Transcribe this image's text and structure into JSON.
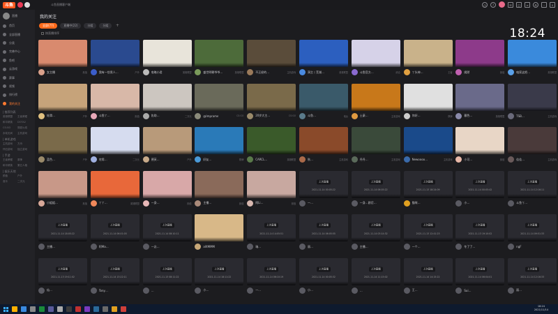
{
  "app": {
    "logo_text": "斗鱼",
    "window_title": "斗鱼直播客户端"
  },
  "titlebar": {
    "icons": [
      "clock-icon",
      "help-icon",
      "avatar",
      "mail-icon",
      "skin-icon",
      "menu-icon",
      "settings-icon",
      "minimize-icon",
      "close-icon"
    ]
  },
  "sidebar": {
    "user": "直播",
    "items": [
      {
        "label": "首页"
      },
      {
        "label": "全部直播"
      },
      {
        "label": "分类"
      },
      {
        "label": "完善中心"
      },
      {
        "label": "鱼吧"
      },
      {
        "label": "云游戏"
      },
      {
        "label": "赛事"
      },
      {
        "label": "视频"
      },
      {
        "label": "排行榜"
      },
      {
        "label": "我的关注"
      }
    ],
    "groups": [
      {
        "title": "| 推荐列表",
        "subs": [
          "英雄联盟",
          "王者荣耀",
          "和平精英",
          "DOTA2",
          "CS:GO",
          "穿越火线",
          "永劫无间",
          "主机游戏"
        ]
      },
      {
        "title": "| 单机游戏",
        "subs": [
          "主机游戏",
          "方舟",
          "怀旧游戏",
          "独立游戏"
        ]
      },
      {
        "title": "| 手游",
        "subs": [
          "王者荣耀",
          "原神",
          "和平精英",
          "第五人格"
        ]
      },
      {
        "title": "| 娱乐天地",
        "subs": [
          "颜值",
          "户外",
          "音乐",
          "二次元"
        ]
      }
    ]
  },
  "main": {
    "title": "我的关注",
    "clock": "18:24",
    "tabs": [
      "全部(77)",
      "直播中(22)",
      "分组",
      "分组"
    ],
    "sort_label": "按直播排序"
  },
  "offline_label": "上次直播",
  "cards": [
    {
      "name": "女主播",
      "game": "颜值",
      "color": "#d98a6e",
      "avatar": "#d9a08a",
      "live": true
    },
    {
      "name": "我有一些男人…",
      "game": "户外",
      "color": "#2a4a8f",
      "avatar": "#3b5dc9",
      "live": true
    },
    {
      "name": "攻略小君",
      "game": "英雄联盟",
      "color": "#e8e4da",
      "avatar": "#bbbbbb",
      "live": true
    },
    {
      "name": "盛世明朝爷爷…",
      "game": "英雄联盟",
      "color": "#4d6b3a",
      "avatar": "#7a9a5a",
      "live": true
    },
    {
      "name": "不正经的…",
      "game": "主机游戏",
      "color": "#5a4c3a",
      "avatar": "#9a7a5a",
      "live": true
    },
    {
      "name": "洞主丨芜湖…",
      "game": "英雄联盟",
      "color": "#2c5fbf",
      "avatar": "#4a8ae0",
      "live": true
    },
    {
      "name": "斗鱼官方…",
      "game": "综合",
      "color": "#d6d2e8",
      "avatar": "#8a6ad0",
      "live": true
    },
    {
      "name": "丫头神…",
      "game": "王者",
      "color": "#c9b28a",
      "avatar": "#e0a040",
      "live": true
    },
    {
      "name": "嫣然",
      "game": "颜值",
      "color": "#8d3a8a",
      "avatar": "#c060b0",
      "live": true
    },
    {
      "name": "咱家这把…",
      "game": "英雄联盟",
      "color": "#3a8adc",
      "avatar": "#5aa0e8",
      "live": true
    },
    {
      "name": "轮滑…",
      "game": "户外",
      "color": "#c6a37a",
      "avatar": "#e0c080",
      "live": true
    },
    {
      "name": "斗鱼丫…",
      "game": "颜值",
      "color": "#d8b8a8",
      "avatar": "#e8a8b8",
      "live": true
    },
    {
      "name": "佐助…",
      "game": "二次元",
      "color": "#ccc6c0",
      "avatar": "#aaaaaa",
      "live": true
    },
    {
      "name": "@Imprame",
      "game": "CS:GO",
      "color": "#6a6a5a",
      "avatar": "#8a8a7a",
      "live": true
    },
    {
      "name": "20岁大主…",
      "game": "CS:GO",
      "color": "#7a6a4a",
      "avatar": "#9a8a6a",
      "live": true
    },
    {
      "name": "斗鱼…",
      "game": "电台",
      "color": "#3a5a6a",
      "avatar": "#5a7a8a",
      "live": true
    },
    {
      "name": "土豪…",
      "game": "主机游戏",
      "color": "#c8781a",
      "avatar": "#e09a40",
      "live": true
    },
    {
      "name": "你好…",
      "game": "棋牌",
      "color": "#e0e0e0",
      "avatar": "#cccccc",
      "live": true
    },
    {
      "name": "暮色…",
      "game": "英雄联盟",
      "color": "#6a6a8a",
      "avatar": "#8a8aaa",
      "live": true
    },
    {
      "name": "TSB…",
      "game": "主机游戏",
      "color": "#3a3a4a",
      "avatar": "#6a6a7a",
      "live": true
    },
    {
      "name": "蓝色…",
      "game": "户外",
      "color": "#7a6a4a",
      "avatar": "#9a8a6a",
      "live": true
    },
    {
      "name": "宅男…",
      "game": "二次元",
      "color": "#d6dcef",
      "avatar": "#a0b0e0",
      "live": true
    },
    {
      "name": "德芙…",
      "game": "户外",
      "color": "#b89a7a",
      "avatar": "#c8aa8a",
      "live": true
    },
    {
      "name": "好友…",
      "game": "棋牌",
      "color": "#2a7ab8",
      "avatar": "#4a9ad8",
      "live": true
    },
    {
      "name": "CARCL…",
      "game": "英雄联盟",
      "color": "#3a5a2a",
      "avatar": "#5a7a4a",
      "live": true
    },
    {
      "name": "秋…",
      "game": "主机游戏",
      "color": "#8a4a2a",
      "avatar": "#aa6a4a",
      "live": true
    },
    {
      "name": "丹丹…",
      "game": "主机游戏",
      "color": "#3a4a3a",
      "avatar": "#5a6a5a",
      "live": true
    },
    {
      "name": "Newoooo…",
      "game": "主机游戏",
      "color": "#1a4a8a",
      "avatar": "#3a6aaa",
      "live": true
    },
    {
      "name": "小可…",
      "game": "颜值",
      "color": "#e8d6c6",
      "avatar": "#e8b8a8",
      "live": true
    },
    {
      "name": "佳佳…",
      "game": "主机游戏",
      "color": "#4a3a3a",
      "avatar": "#6a5a5a",
      "live": true
    },
    {
      "name": "小姐姐…",
      "game": "颜值",
      "color": "#c89888",
      "avatar": "#d8a898",
      "live": true
    },
    {
      "name": "丫丫…",
      "game": "英雄联盟",
      "color": "#e8683a",
      "avatar": "#f0885a",
      "live": true
    },
    {
      "name": "一身…",
      "game": "颜值",
      "color": "#d8a8a8",
      "avatar": "#e8b8b8",
      "live": true
    },
    {
      "name": "主播…",
      "game": "颜值",
      "color": "#8a6a5a",
      "avatar": "#aa8a7a",
      "live": true
    },
    {
      "name": "阿Li…",
      "game": "颜值",
      "color": "#c8a8a0",
      "avatar": "#d8b8b0",
      "live": true
    },
    {
      "name": "一…",
      "game": "",
      "color": "#2a2a30",
      "avatar": "#5a5a62",
      "live": false,
      "date": "2021-11-14 00:05:22"
    },
    {
      "name": "一身…欧尼…",
      "game": "",
      "color": "#2a2a30",
      "avatar": "#5a5a62",
      "live": false,
      "date": "2021-11-14 06:05:22"
    },
    {
      "name": "猫咪…",
      "game": "",
      "color": "#2a2a30",
      "avatar": "#e0a020",
      "live": false,
      "date": "2021-11-13 18:24:09"
    },
    {
      "name": "小…",
      "game": "",
      "color": "#2a2a30",
      "avatar": "#5a5a62",
      "live": false,
      "date": "2021-11-14 00:05:42"
    },
    {
      "name": "斗鱼丫…",
      "game": "",
      "color": "#2a2a30",
      "avatar": "#5a5a62",
      "live": false,
      "date": "2021-11-14 12:16:11"
    },
    {
      "name": "主播…",
      "game": "",
      "color": "#2a2a30",
      "avatar": "#5a5a62",
      "live": false,
      "date": "2021-11-14 18:05:22"
    },
    {
      "name": "阿Ma…",
      "game": "",
      "color": "#2a2a30",
      "avatar": "#5a5a62",
      "live": false,
      "date": "2021-11-14 06:01:05"
    },
    {
      "name": "一念…",
      "game": "",
      "color": "#2a2a30",
      "avatar": "#5a5a62",
      "live": false,
      "date": "2021-11-14 08:10:11"
    },
    {
      "name": "alltMMM",
      "game": "",
      "color": "#d8b888",
      "avatar": "#c8a878",
      "live": true
    },
    {
      "name": "瑞…",
      "game": "",
      "color": "#2a2a30",
      "avatar": "#5a5a62",
      "live": false,
      "date": "2021-11-14 14:05:51"
    },
    {
      "name": "丽…",
      "game": "",
      "color": "#2a2a30",
      "avatar": "#5a5a62",
      "live": false,
      "date": "2021-11-14 06:05:55"
    },
    {
      "name": "主播…",
      "game": "",
      "color": "#2a2a30",
      "avatar": "#5a5a62",
      "live": false,
      "date": "2021-11-14 03:14:32"
    },
    {
      "name": "一个…",
      "game": "",
      "color": "#2a2a30",
      "avatar": "#5a5a62",
      "live": false,
      "date": "2021-11-13 12:41:23"
    },
    {
      "name": "冬了了…",
      "game": "",
      "color": "#2a2a30",
      "avatar": "#5a5a62",
      "live": false,
      "date": "2021-11-13 19:10:02"
    },
    {
      "name": "ngF",
      "game": "",
      "color": "#2a2a30",
      "avatar": "#5a5a62",
      "live": false,
      "date": "2021-11-14 09:51:33"
    },
    {
      "name": "仙…",
      "game": "",
      "color": "#2a2a30",
      "avatar": "#5a5a62",
      "live": false,
      "date": "2021-11-13 19:11:02"
    },
    {
      "name": "Tony…",
      "game": "",
      "color": "#2a2a30",
      "avatar": "#5a5a62",
      "live": false,
      "date": "2021-11-14 13:22:11"
    },
    {
      "name": "…",
      "game": "",
      "color": "#2a2a30",
      "avatar": "#5a5a62",
      "live": false,
      "date": "2021-11-13 08:11:22"
    },
    {
      "name": "小…",
      "game": "",
      "color": "#2a2a30",
      "avatar": "#5a5a62",
      "live": false,
      "date": "2021-11-14 18:11:22"
    },
    {
      "name": "一…",
      "game": "",
      "color": "#2a2a30",
      "avatar": "#5a5a62",
      "live": false,
      "date": "2021-11-14 06:10:19"
    },
    {
      "name": "小…",
      "game": "",
      "color": "#2a2a30",
      "avatar": "#5a5a62",
      "live": false,
      "date": "2021-11-14 00:05:32"
    },
    {
      "name": "…",
      "game": "",
      "color": "#2a2a30",
      "avatar": "#5a5a62",
      "live": false,
      "date": "2021-11-14 11:15:02"
    },
    {
      "name": "王…",
      "game": "",
      "color": "#2a2a30",
      "avatar": "#5a5a62",
      "live": false,
      "date": "2021-11-14 14:15:22"
    },
    {
      "name": "Sui…",
      "game": "",
      "color": "#2a2a30",
      "avatar": "#5a5a62",
      "live": false,
      "date": "2021-11-14 06:04:01"
    },
    {
      "name": "丽…",
      "game": "",
      "color": "#2a2a30",
      "avatar": "#5a5a62",
      "live": false,
      "date": "2021-11-14 12:16:33"
    }
  ],
  "taskbar": {
    "time": "18:24",
    "date": "2021/11/14"
  },
  "colors": {
    "accent": "#ff6a1a",
    "bg": "#1c1c1f"
  }
}
